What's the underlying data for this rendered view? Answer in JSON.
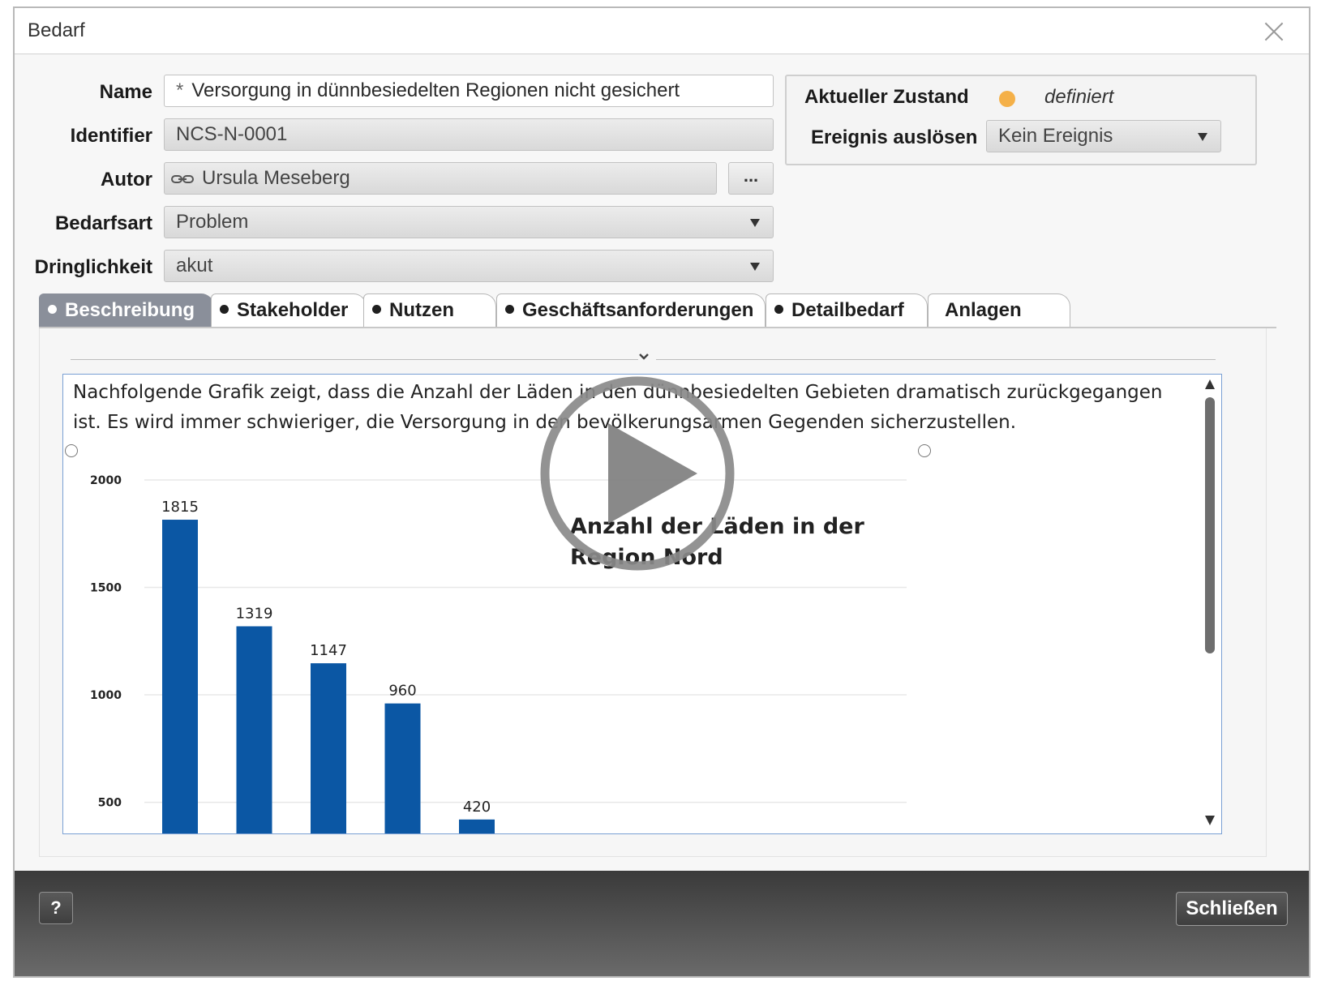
{
  "window": {
    "title": "Bedarf"
  },
  "form": {
    "name_label": "Name",
    "name_prefix": "*",
    "name_value": "Versorgung in dünnbesiedelten Regionen nicht gesichert",
    "identifier_label": "Identifier",
    "identifier_value": "NCS-N-0001",
    "autor_label": "Autor",
    "autor_value": "Ursula Meseberg",
    "autor_more_label": "...",
    "bedarfsart_label": "Bedarfsart",
    "bedarfsart_value": "Problem",
    "dringlichkeit_label": "Dringlichkeit",
    "dringlichkeit_value": "akut"
  },
  "state": {
    "current_label": "Aktueller Zustand",
    "current_value": "definiert",
    "status_color": "#f4b048",
    "event_label": "Ereignis auslösen",
    "event_value": "Kein Ereignis"
  },
  "tabs": [
    {
      "label": "Beschreibung",
      "active": true,
      "bullet": true
    },
    {
      "label": "Stakeholder",
      "active": false,
      "bullet": true
    },
    {
      "label": "Nutzen",
      "active": false,
      "bullet": true
    },
    {
      "label": "Geschäftsanforderungen",
      "active": false,
      "bullet": true
    },
    {
      "label": "Detailbedarf",
      "active": false,
      "bullet": true
    },
    {
      "label": "Anlagen",
      "active": false,
      "bullet": false
    }
  ],
  "description": {
    "text": "Nachfolgende Grafik zeigt, dass die Anzahl der Läden in den dünnbesiedelten Gebieten dramatisch zurückgegangen ist. Es wird immer schwieriger, die Versorgung in den bevölkerungsarmen Gegenden sicherzustellen."
  },
  "chart_data": {
    "type": "bar",
    "title": "Anzahl der Läden in der Region Nord",
    "categories": [
      "",
      "",
      "",
      "",
      ""
    ],
    "values": [
      1815,
      1319,
      1147,
      960,
      420
    ],
    "data_labels": [
      "1815",
      "1319",
      "1147",
      "960",
      "420"
    ],
    "yticks": [
      "500",
      "1000",
      "1500",
      "2000"
    ],
    "ylim": [
      340,
      2000
    ],
    "grid": true,
    "bar_color": "#0b57a4"
  },
  "footer": {
    "help_label": "?",
    "close_label": "Schließen"
  }
}
